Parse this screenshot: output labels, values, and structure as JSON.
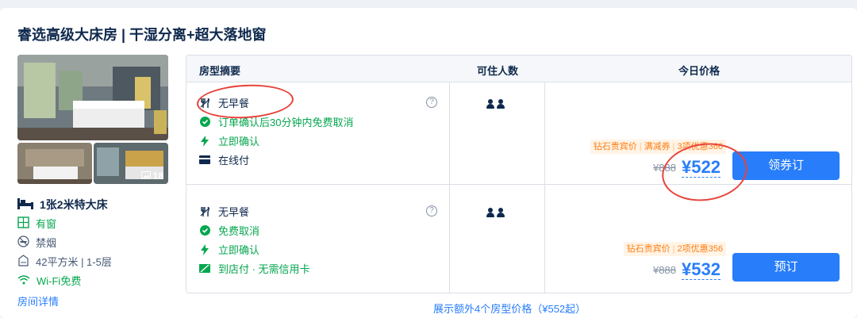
{
  "room": {
    "title": "睿选高级大床房 | 干湿分离+超大落地窗",
    "photo_count": "18",
    "bed": "1张2米特大床",
    "window": "有窗",
    "smoking": "禁烟",
    "area_floor": "42平方米 | 1-5层",
    "wifi": "Wi-Fi免费",
    "details_link": "房间详情"
  },
  "table": {
    "headers": {
      "summary": "房型摘要",
      "occupancy": "可住人数",
      "price": "今日价格"
    },
    "rows": [
      {
        "features": [
          "无早餐",
          "订单确认后30分钟内免费取消",
          "立即确认",
          "在线付"
        ],
        "promo": {
          "member": "钻石贵宾价",
          "coupon": "满减券",
          "offers": "3项优惠366"
        },
        "original_price": "¥888",
        "price": "¥522",
        "button": "领券订"
      },
      {
        "features": [
          "无早餐",
          "免费取消",
          "立即确认",
          "到店付 · 无需信用卡"
        ],
        "promo": {
          "member": "钻石贵宾价",
          "offers": "2项优惠356"
        },
        "original_price": "¥888",
        "price": "¥532",
        "button": "预订"
      }
    ],
    "more_link": "展示额外4个房型价格（¥552起）"
  },
  "colors": {
    "accent": "#287dfa",
    "green": "#06a64f",
    "promo": "#ff7d13",
    "annotation": "#e8433a"
  }
}
